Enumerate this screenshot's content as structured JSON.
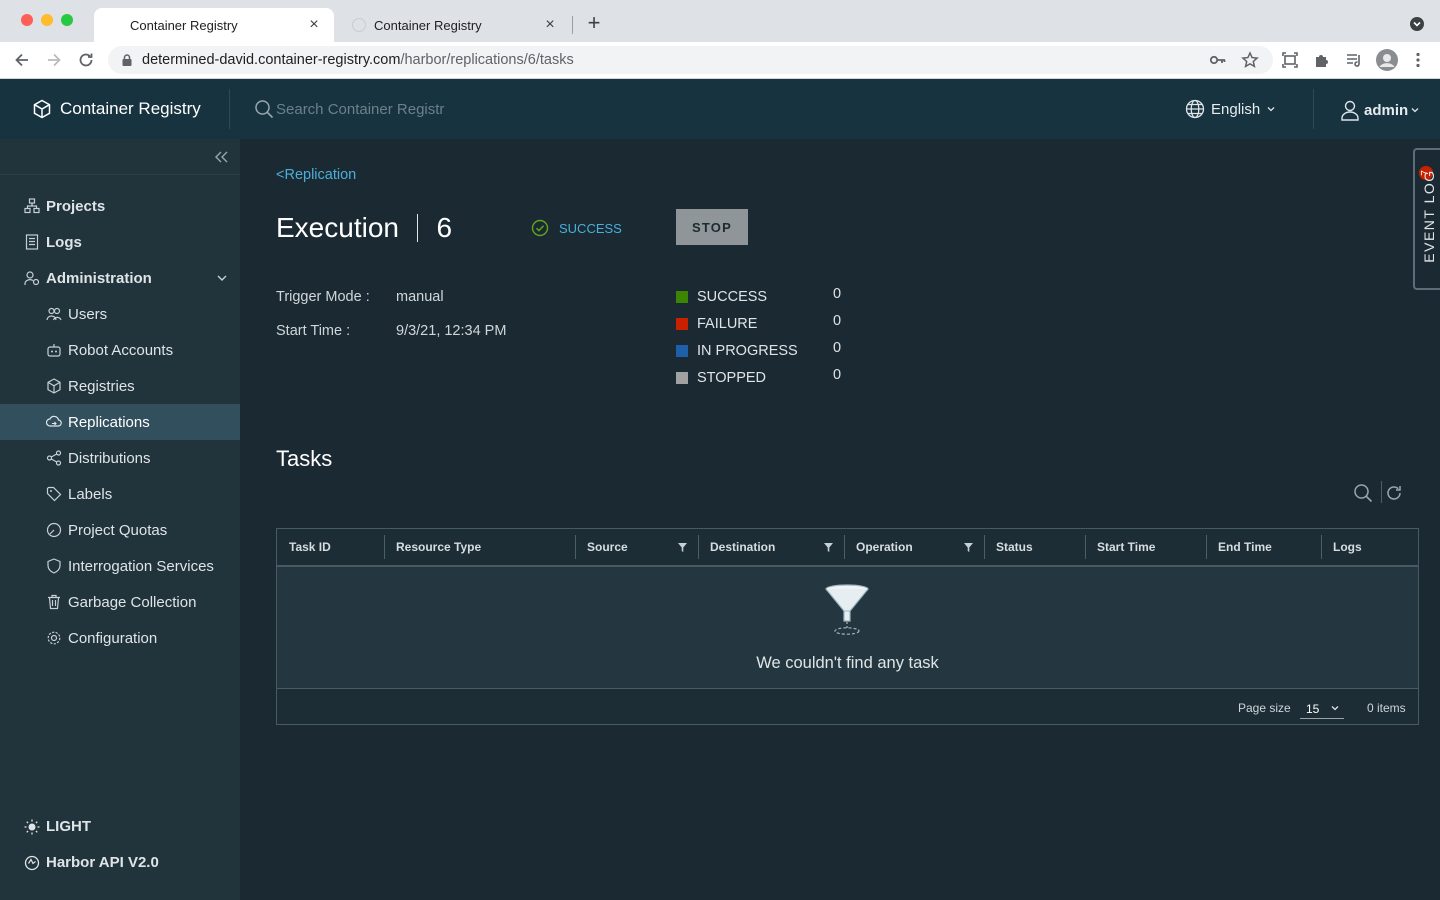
{
  "browser": {
    "tabs": [
      {
        "title": "Container Registry",
        "active": true
      },
      {
        "title": "Container Registry",
        "active": false
      }
    ],
    "url_host": "determined-david.container-registry.com",
    "url_path": "/harbor/replications/6/tasks"
  },
  "header": {
    "app_title": "Container Registry",
    "search_placeholder": "Search Container Registr",
    "language": "English",
    "user": "admin"
  },
  "sidebar": {
    "items": [
      {
        "label": "Projects",
        "icon": "projects-icon"
      },
      {
        "label": "Logs",
        "icon": "logs-icon"
      },
      {
        "label": "Administration",
        "icon": "administration-icon"
      },
      {
        "label": "Users",
        "icon": "users-icon"
      },
      {
        "label": "Robot Accounts",
        "icon": "robot-icon"
      },
      {
        "label": "Registries",
        "icon": "registries-icon"
      },
      {
        "label": "Replications",
        "icon": "replications-icon",
        "active": true
      },
      {
        "label": "Distributions",
        "icon": "distributions-icon"
      },
      {
        "label": "Labels",
        "icon": "labels-icon"
      },
      {
        "label": "Project Quotas",
        "icon": "quotas-icon"
      },
      {
        "label": "Interrogation Services",
        "icon": "shield-icon"
      },
      {
        "label": "Garbage Collection",
        "icon": "trash-icon"
      },
      {
        "label": "Configuration",
        "icon": "gear-icon"
      }
    ],
    "theme_toggle": "LIGHT",
    "api_link": "Harbor API V2.0"
  },
  "main": {
    "back_link": "<Replication",
    "title": "Execution",
    "execution_id": "6",
    "status": "SUCCESS",
    "stop_button": "STOP",
    "trigger_mode_label": "Trigger Mode :",
    "trigger_mode_value": "manual",
    "start_time_label": "Start Time :",
    "start_time_value": "9/3/21, 12:34 PM",
    "stats": [
      {
        "label": "SUCCESS",
        "count": "0",
        "color": "#3c8500"
      },
      {
        "label": "FAILURE",
        "count": "0",
        "color": "#c92100"
      },
      {
        "label": "IN PROGRESS",
        "count": "0",
        "color": "#1d5fa8"
      },
      {
        "label": "STOPPED",
        "count": "0",
        "color": "#a1a1a1"
      }
    ],
    "tasks_title": "Tasks",
    "columns": [
      "Task ID",
      "Resource Type",
      "Source",
      "Destination",
      "Operation",
      "Status",
      "Start Time",
      "End Time",
      "Logs"
    ],
    "empty_message": "We couldn't find any task",
    "page_size_label": "Page size",
    "page_size_value": "15",
    "items_count": "0 items"
  },
  "event_log": {
    "label": "EVENT LOG",
    "badge": "7"
  },
  "colors": {
    "accent": "#4aaed9",
    "header_bg": "#17333f",
    "sidebar_bg": "#21333b",
    "success": "#3c8500"
  }
}
